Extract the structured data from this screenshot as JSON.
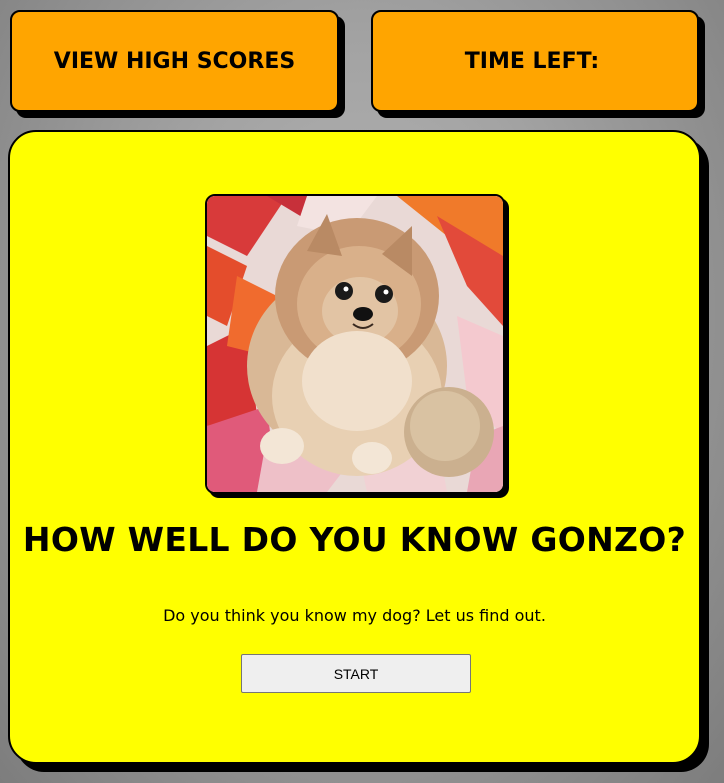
{
  "header": {
    "high_scores_label": "VIEW HIGH SCORES",
    "timer_label": "TIME LEFT:",
    "timer_value": ""
  },
  "main": {
    "image_alt": "Gonzo",
    "title": "HOW WELL DO YOU KNOW GONZO?",
    "subtitle": "Do you think you know my dog? Let us find out.",
    "start_label": "START"
  },
  "colors": {
    "background": "#a3a3a3",
    "header_button": "#ffa500",
    "card": "#ffff00",
    "border": "#000000"
  }
}
